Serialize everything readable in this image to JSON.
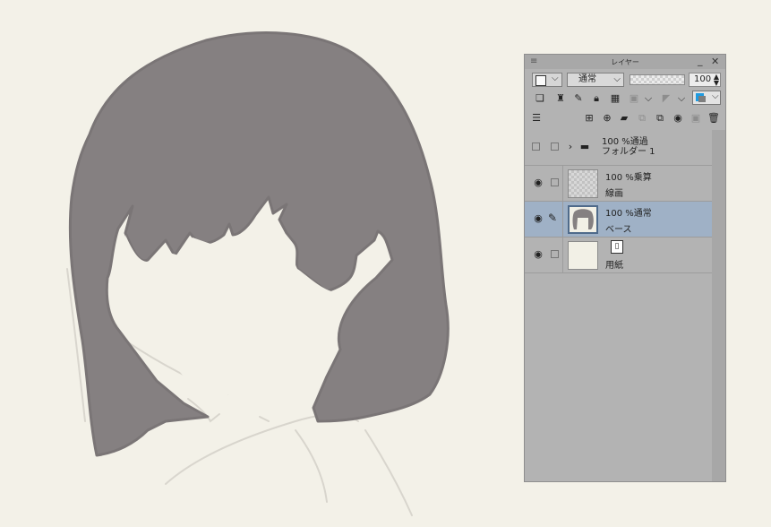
{
  "panel": {
    "title": "レイヤー",
    "blend_mode": "通常",
    "opacity": "100",
    "toolbar_row2_icons": [
      "layer-clip-icon",
      "reference-icon",
      "draft-icon",
      "lock-icon",
      "lock-alpha-icon",
      "mask-disabled-icon",
      "chevron-down-icon",
      "ruler-disabled-icon",
      "chevron-down-icon",
      "layer-color-icon"
    ],
    "toolbar_row3_icons": [
      "panel-menu-icon",
      "new-raster-icon",
      "new-vector-icon",
      "new-folder-icon",
      "transfer-down-icon",
      "merge-down-icon",
      "mask-icon",
      "apply-mask-icon",
      "delete-icon"
    ],
    "colors": {
      "accent": "#1f9be0",
      "selected_row": "#9fb1c6",
      "panel_bg": "#b3b3b3"
    }
  },
  "layers": [
    {
      "mode": "100 %通過",
      "name": "フォルダー 1",
      "type": "folder",
      "visible": false,
      "selected": false
    },
    {
      "mode": "100 %乗算",
      "name": "線画",
      "type": "raster",
      "visible": true,
      "selected": false
    },
    {
      "mode": "100 %通常",
      "name": "ベース",
      "type": "raster",
      "visible": true,
      "selected": true
    },
    {
      "mode": "",
      "name": "用紙",
      "type": "paper",
      "visible": true,
      "selected": false
    }
  ],
  "canvas": {
    "background": "#f3f1e8",
    "hair_color": "#858081"
  }
}
